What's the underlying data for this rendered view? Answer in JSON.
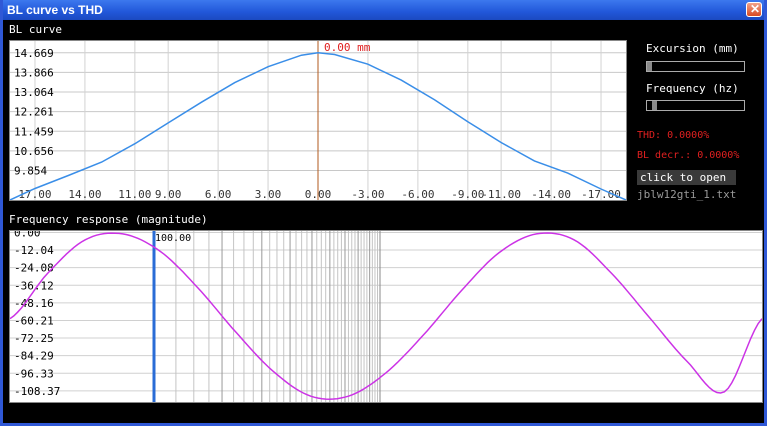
{
  "window": {
    "title": "BL curve vs THD"
  },
  "bl_panel": {
    "label": "BL curve",
    "cursor_label": "0.00 mm"
  },
  "freq_panel": {
    "label": "Frequency response (magnitude)",
    "cursor_label": "100.00"
  },
  "controls": {
    "excursion": {
      "label": "Excursion (mm)",
      "value": 0
    },
    "frequency": {
      "label": "Frequency (hz)",
      "value": 0.05
    },
    "thd": "THD: 0.0000%",
    "bl_decr": "BL decr.: 0.0000%",
    "open_button": "click to open",
    "filename": "jblw12gti_1.txt"
  },
  "colors": {
    "bl_curve": "#3a8ee8",
    "freq_curve": "#cc33e6",
    "cursor_bl": "#b05a1e",
    "cursor_freq": "#2a6cd6",
    "text_red": "#e02020"
  },
  "chart_data": [
    {
      "type": "line",
      "title": "BL curve",
      "x_ticks": [
        "17.00",
        "14.00",
        "11.00",
        "9.00",
        "6.00",
        "3.00",
        "0.00",
        "-3.00",
        "-6.00",
        "-9.00",
        "-11.00",
        "-14.00",
        "-17.00"
      ],
      "y_ticks": [
        "14.669",
        "13.866",
        "13.064",
        "12.261",
        "11.459",
        "10.656",
        "9.854"
      ],
      "xlim": [
        18.5,
        -18.5
      ],
      "ylim": [
        8.65,
        15.15
      ],
      "x": [
        18.5,
        17,
        15,
        13,
        11,
        9,
        7,
        5,
        3,
        1,
        0,
        -1,
        -3,
        -5,
        -7,
        -9,
        -11,
        -13,
        -15,
        -17,
        -18.5
      ],
      "y": [
        8.65,
        9.12,
        9.65,
        10.2,
        10.95,
        11.8,
        12.65,
        13.45,
        14.1,
        14.57,
        14.67,
        14.6,
        14.2,
        13.55,
        12.75,
        11.85,
        11.0,
        10.25,
        9.75,
        9.1,
        8.65
      ],
      "cursor_x": 0,
      "grid": true
    },
    {
      "type": "line",
      "title": "Frequency response (magnitude)",
      "y_ticks": [
        "0.00",
        "-12.04",
        "-24.08",
        "-36.12",
        "-48.16",
        "-60.21",
        "-72.25",
        "-84.29",
        "-96.33",
        "-108.37"
      ],
      "ylim": [
        -116,
        1
      ],
      "x": [
        0,
        0.05,
        0.1,
        0.15,
        0.2,
        0.25,
        0.3,
        0.35,
        0.4,
        0.45,
        0.5,
        0.55,
        0.6,
        0.65,
        0.7,
        0.75,
        0.8,
        0.85,
        0.9,
        0.95,
        1.0
      ],
      "y": [
        -59,
        -28,
        -5,
        -1,
        -13,
        -38,
        -68,
        -95,
        -112,
        -112,
        -96,
        -70,
        -40,
        -14,
        -1,
        -5,
        -28,
        -58,
        -88,
        -109,
        -59
      ],
      "cursor_value": 100.0,
      "grid": true
    }
  ]
}
